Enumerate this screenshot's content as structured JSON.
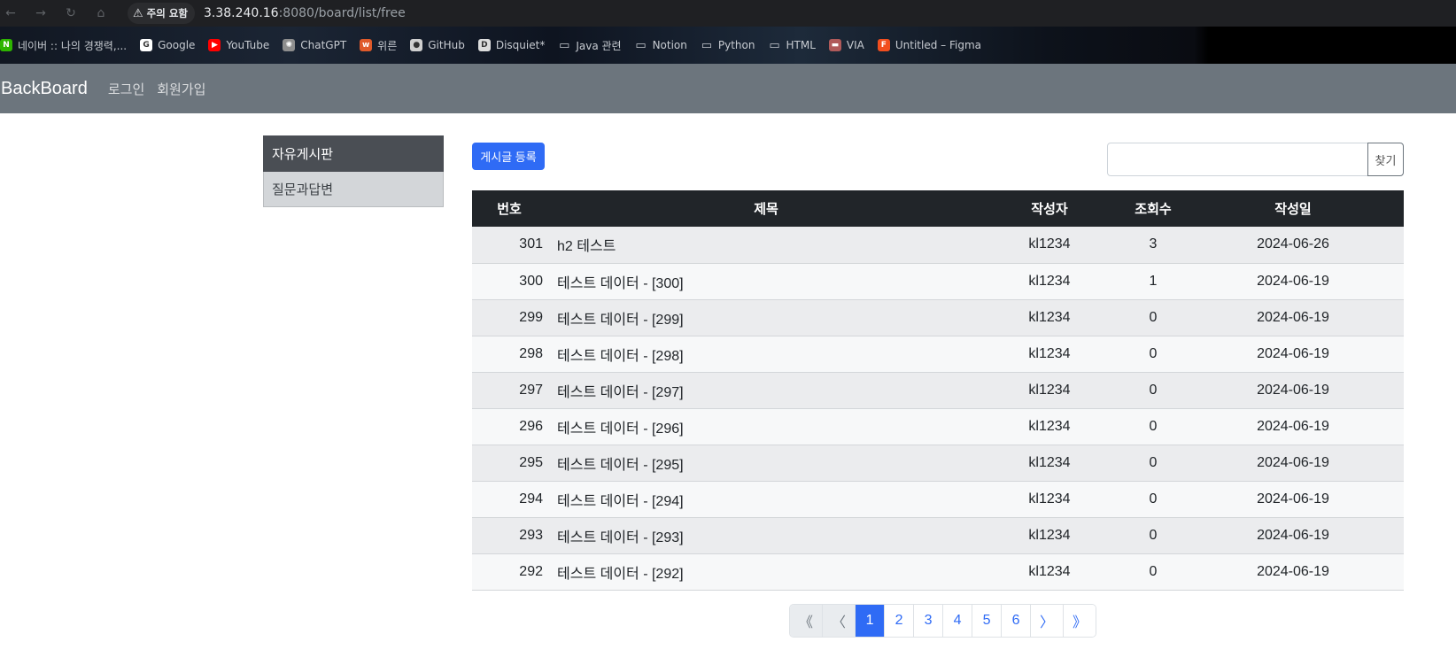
{
  "browser": {
    "security_chip": "주의 요함",
    "url_host": "3.38.240.16",
    "url_rest": ":8080/board/list/free",
    "bookmarks": [
      {
        "label": "네이버 :: 나의 경쟁력,...",
        "icon": "naver-icon",
        "color": "#2db400",
        "glyph": "N"
      },
      {
        "label": "Google",
        "icon": "google-icon",
        "color": "#ffffff",
        "glyph": "G"
      },
      {
        "label": "YouTube",
        "icon": "youtube-icon",
        "color": "#ff0000",
        "glyph": "▶"
      },
      {
        "label": "ChatGPT",
        "icon": "chatgpt-icon",
        "color": "#8e8e8e",
        "glyph": "✺"
      },
      {
        "label": "위른",
        "icon": "wiren-icon",
        "color": "#e05a2a",
        "glyph": "w"
      },
      {
        "label": "GitHub",
        "icon": "github-icon",
        "color": "#cfcfcf",
        "glyph": "●"
      },
      {
        "label": "Disquiet*",
        "icon": "disquiet-icon",
        "color": "#dddddd",
        "glyph": "D"
      },
      {
        "label": "Java 관련",
        "icon": "folder-icon",
        "color": "",
        "glyph": "▭"
      },
      {
        "label": "Notion",
        "icon": "folder-icon",
        "color": "",
        "glyph": "▭"
      },
      {
        "label": "Python",
        "icon": "folder-icon",
        "color": "",
        "glyph": "▭"
      },
      {
        "label": "HTML",
        "icon": "folder-icon",
        "color": "",
        "glyph": "▭"
      },
      {
        "label": "VIA",
        "icon": "via-icon",
        "color": "#b05a5a",
        "glyph": "▬"
      },
      {
        "label": "Untitled – Figma",
        "icon": "figma-icon",
        "color": "#f24e1e",
        "glyph": "F"
      }
    ]
  },
  "navbar": {
    "brand": "BackBoard",
    "login": "로그인",
    "signup": "회원가입"
  },
  "sidebar": {
    "items": [
      {
        "label": "자유게시판",
        "active": true
      },
      {
        "label": "질문과답변",
        "active": false
      }
    ]
  },
  "toolbar": {
    "new_post": "게시글 등록",
    "search_value": "",
    "search_button": "찾기"
  },
  "table": {
    "headers": [
      "번호",
      "제목",
      "작성자",
      "조회수",
      "작성일"
    ],
    "rows": [
      {
        "num": "301",
        "title": "h2 테스트",
        "author": "kl1234",
        "views": "3",
        "date": "2024-06-26"
      },
      {
        "num": "300",
        "title": "테스트 데이터 - [300]",
        "author": "kl1234",
        "views": "1",
        "date": "2024-06-19"
      },
      {
        "num": "299",
        "title": "테스트 데이터 - [299]",
        "author": "kl1234",
        "views": "0",
        "date": "2024-06-19"
      },
      {
        "num": "298",
        "title": "테스트 데이터 - [298]",
        "author": "kl1234",
        "views": "0",
        "date": "2024-06-19"
      },
      {
        "num": "297",
        "title": "테스트 데이터 - [297]",
        "author": "kl1234",
        "views": "0",
        "date": "2024-06-19"
      },
      {
        "num": "296",
        "title": "테스트 데이터 - [296]",
        "author": "kl1234",
        "views": "0",
        "date": "2024-06-19"
      },
      {
        "num": "295",
        "title": "테스트 데이터 - [295]",
        "author": "kl1234",
        "views": "0",
        "date": "2024-06-19"
      },
      {
        "num": "294",
        "title": "테스트 데이터 - [294]",
        "author": "kl1234",
        "views": "0",
        "date": "2024-06-19"
      },
      {
        "num": "293",
        "title": "테스트 데이터 - [293]",
        "author": "kl1234",
        "views": "0",
        "date": "2024-06-19"
      },
      {
        "num": "292",
        "title": "테스트 데이터 - [292]",
        "author": "kl1234",
        "views": "0",
        "date": "2024-06-19"
      }
    ]
  },
  "pagination": {
    "first": "《",
    "prev": "〈",
    "pages": [
      "1",
      "2",
      "3",
      "4",
      "5",
      "6"
    ],
    "current": "1",
    "next": "〉",
    "last": "》"
  },
  "colors": {
    "accent": "#2f6bf5",
    "navbar": "#6c757d",
    "table_header": "#212529"
  }
}
